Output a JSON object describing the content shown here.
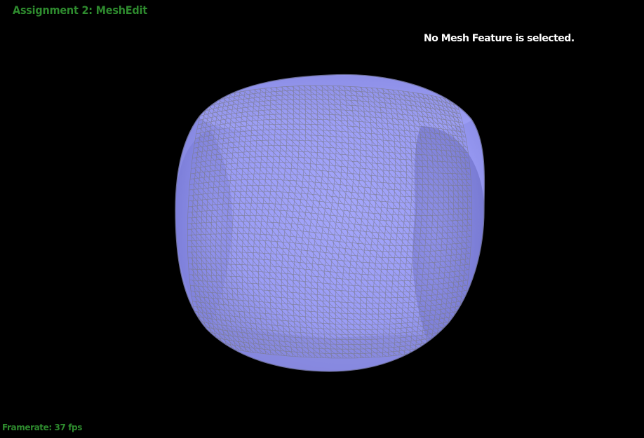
{
  "app": {
    "title": "Assignment 2: MeshEdit"
  },
  "status": {
    "message": "No Mesh Feature is selected."
  },
  "footer": {
    "framerate": "Framerate: 37 fps"
  },
  "viewport": {
    "background_color": "#000000",
    "mesh_fill_color": "#9a9cf6",
    "mesh_wire_color": "#7a7a8a",
    "title_color": "#2e8b2e"
  }
}
